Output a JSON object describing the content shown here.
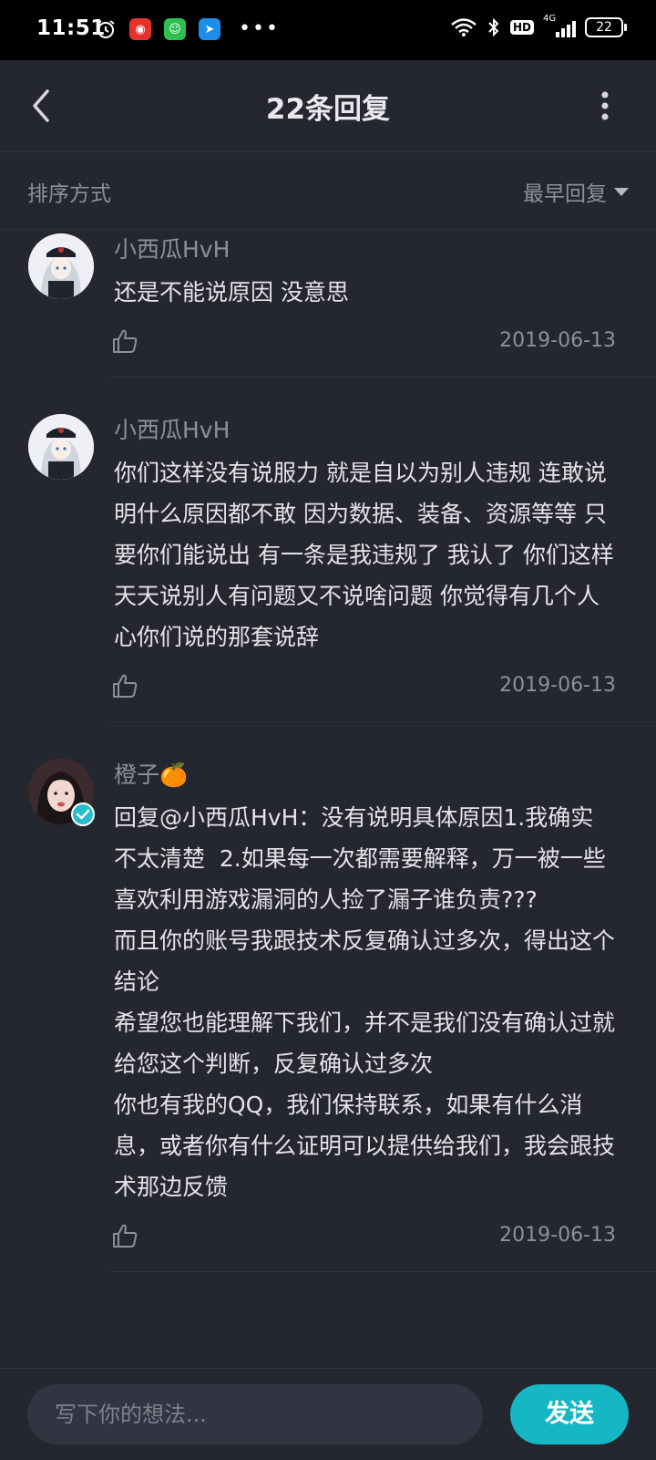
{
  "status_bar": {
    "time": "11:51",
    "battery": "22",
    "network": "4G",
    "hd": "HD"
  },
  "header": {
    "title": "22条回复"
  },
  "sort": {
    "label": "排序方式",
    "selected": "最早回复"
  },
  "comments": [
    {
      "name": "小西瓜HvH",
      "text": "还是不能说原因 没意思",
      "date": "2019-06-13"
    },
    {
      "name": "小西瓜HvH",
      "text": "你们这样没有说服力 就是自以为别人违规 连敢说明什么原因都不敢 因为数据、装备、资源等等 只要你们能说出 有一条是我违规了 我认了 你们这样天天说别人有问题又不说啥问题 你觉得有几个人心你们说的那套说辞",
      "date": "2019-06-13"
    },
    {
      "name": "橙子🍊",
      "text": "回复@小西瓜HvH：没有说明具体原因1.我确实不太清楚  2.如果每一次都需要解释，万一被一些喜欢利用游戏漏洞的人捡了漏子谁负责???\n而且你的账号我跟技术反复确认过多次，得出这个结论\n希望您也能理解下我们，并不是我们没有确认过就给您这个判断，反复确认过多次\n你也有我的QQ，我们保持联系，如果有什么消息，或者你有什么证明可以提供给我们，我会跟技术那边反馈",
      "date": "2019-06-13"
    }
  ],
  "input": {
    "placeholder": "写下你的想法...",
    "send_label": "发送"
  },
  "colors": {
    "background": "#252730",
    "accent": "#16b7c4",
    "muted_text": "#8d909a"
  }
}
